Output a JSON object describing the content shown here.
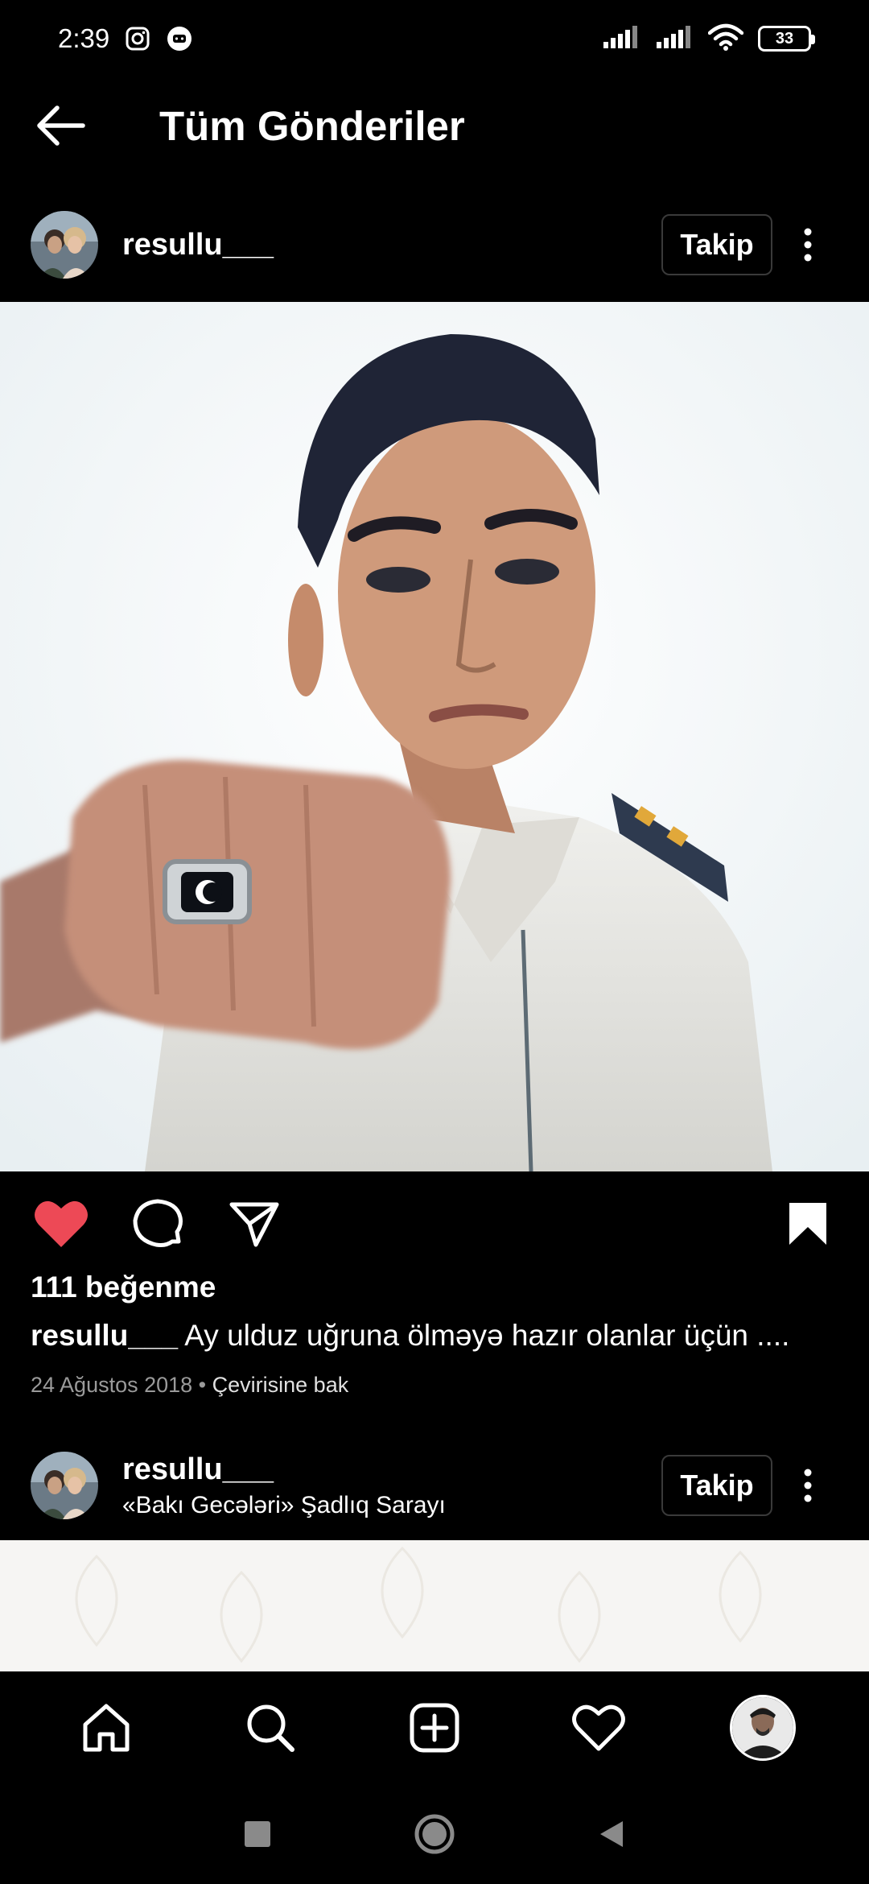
{
  "status_bar": {
    "time": "2:39",
    "battery": "33"
  },
  "header": {
    "title": "Tüm Gönderiler"
  },
  "post1": {
    "username": "resullu___",
    "follow_label": "Takip",
    "likes": "111 beğenme",
    "caption_user": "resullu___",
    "caption_text": " Ay ulduz uğruna ölməyə hazır olanlar üçün ....",
    "date": "24 Ağustos 2018",
    "separator": " • ",
    "translate": "Çevirisine bak",
    "liked": true
  },
  "post2": {
    "username": "resullu___",
    "location": "«Bakı Gecələri» Şadlıq Sarayı",
    "follow_label": "Takip"
  },
  "colors": {
    "like_red": "#ed4956",
    "background": "#000000",
    "text": "#ffffff",
    "muted": "#9a9a9a"
  },
  "icons": {
    "back": "arrow-left-icon",
    "more": "more-vertical-icon",
    "like": "heart-filled-icon",
    "comment": "comment-icon",
    "share": "send-icon",
    "save": "bookmark-filled-icon",
    "home": "home-icon",
    "search": "search-icon",
    "create": "plus-square-icon",
    "activity": "heart-icon",
    "profile": "avatar"
  }
}
